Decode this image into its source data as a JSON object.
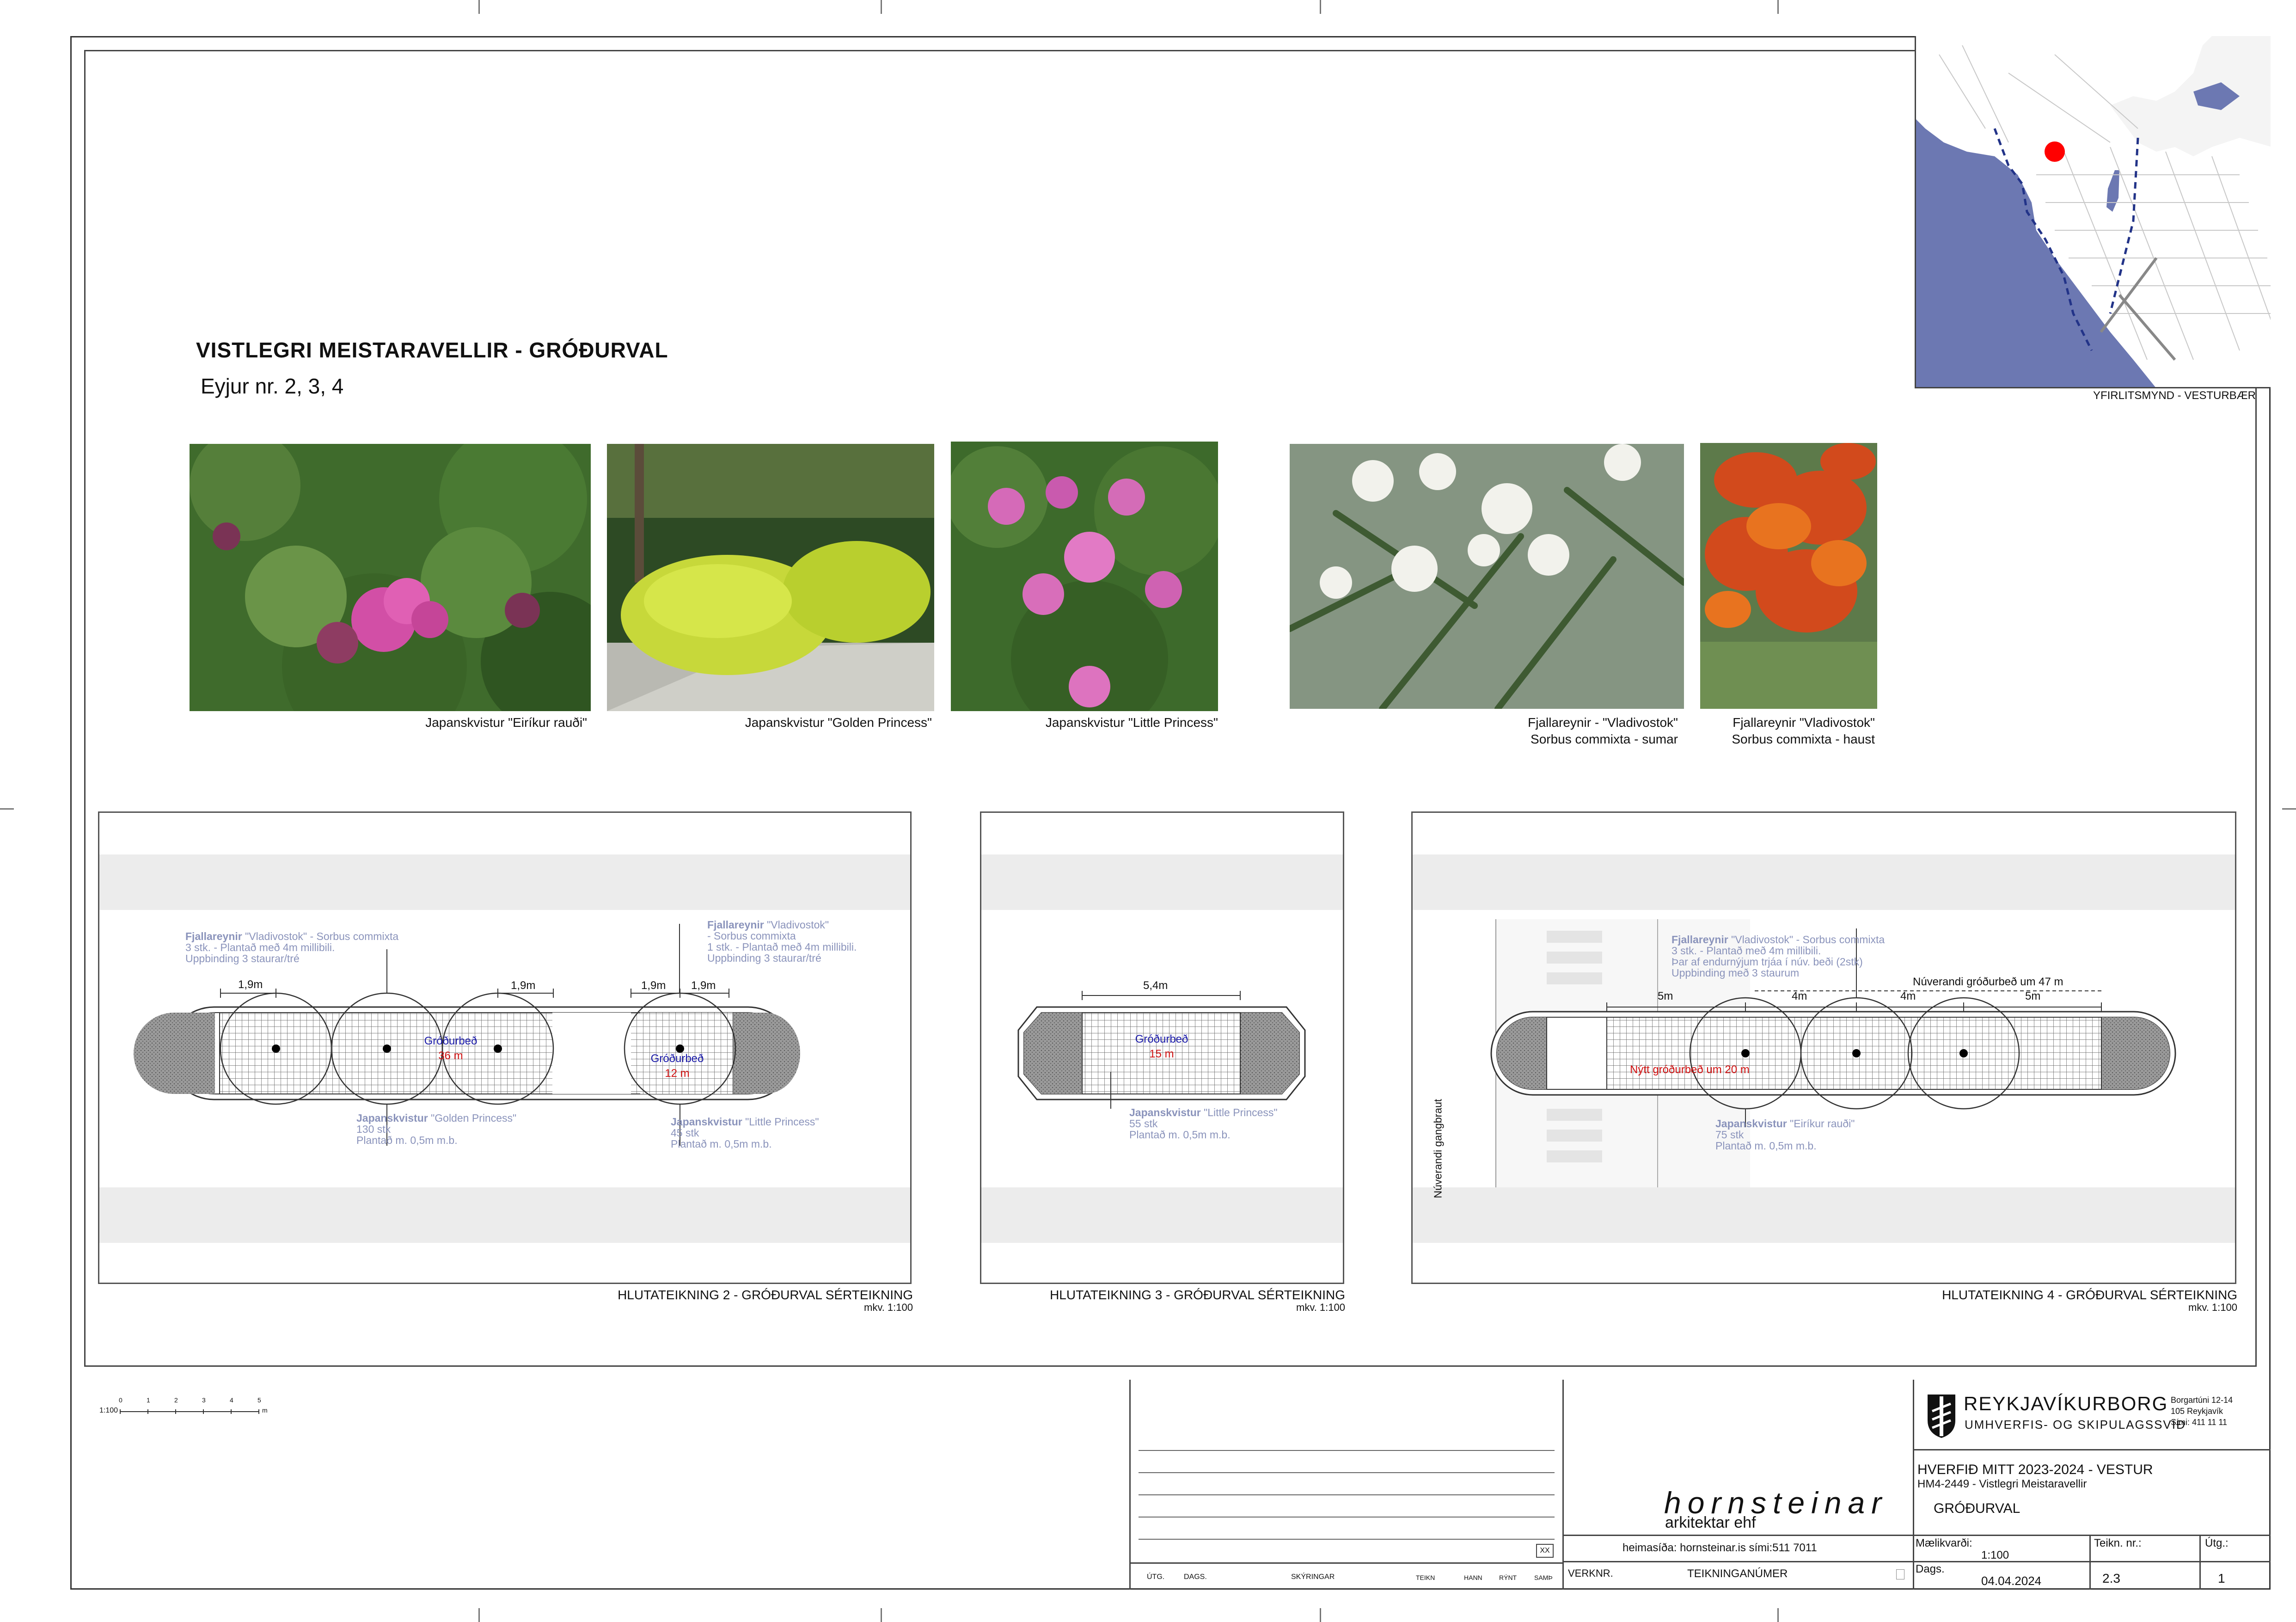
{
  "sheet": {
    "title": "VISTLEGRI MEISTARAVELLIR - GRÓÐURVAL",
    "subtitle": "Eyjur nr. 2, 3, 4"
  },
  "location_map": {
    "caption": "YFIRLITSMYND - VESTURBÆR",
    "marker_color": "#ff0000",
    "sea_color": "#6c78b2"
  },
  "photos": [
    {
      "caption": "Japanskvistur \"Eiríkur rauði\""
    },
    {
      "caption": "Japanskvistur \"Golden Princess\""
    },
    {
      "caption": "Japanskvistur \"Little Princess\""
    },
    {
      "caption_1": "Fjallareynir - \"Vladivostok\"",
      "caption_2": "Sorbus commixta - sumar"
    },
    {
      "caption_1": "Fjallareynir \"Vladivostok\"",
      "caption_2": "Sorbus commixta - haust"
    }
  ],
  "panel2": {
    "title": "HLUTATEIKNING 2 - GRÓÐURVAL SÉRTEIKNING",
    "scale": "mkv. 1:100",
    "note_trees_left": {
      "line1_bold": "Fjallareynir",
      "line1_rest": " \"Vladivostok\" - Sorbus commixta",
      "line2": "3 stk. - Plantað með 4m millibili.",
      "line3": "Uppbinding 3 staurar/tré"
    },
    "note_trees_right": {
      "line1_bold": "Fjallareynir",
      "line1_rest": " \"Vladivostok\"",
      "line2": "- Sorbus commixta",
      "line3": "1 stk. - Plantað með 4m millibili.",
      "line4": "Uppbinding 3 staurar/tré"
    },
    "dim_1": "1,9m",
    "dim_2": "1,9m",
    "dim_3": "1,9m",
    "dim_4": "1,9m",
    "bed_a_label": "Gróðurbeð",
    "bed_a_area": "36 m",
    "bed_b_label": "Gróðurbeð",
    "bed_b_area": "12 m",
    "note_shrub_a": {
      "line1_bold": "Japanskvistur",
      "line1_rest": " \"Golden Princess\"",
      "line2": "130 stk",
      "line3": "Plantað m. 0,5m m.b."
    },
    "note_shrub_b": {
      "line1_bold": "Japanskvistur",
      "line1_rest": " \"Little Princess\"",
      "line2": "45 stk",
      "line3": "Plantað m. 0,5m m.b."
    }
  },
  "panel3": {
    "title": "HLUTATEIKNING 3 - GRÓÐURVAL SÉRTEIKNING",
    "scale": "mkv. 1:100",
    "dim": "5,4m",
    "bed_label": "Gróðurbeð",
    "bed_area": "15 m",
    "note_shrub": {
      "line1_bold": "Japanskvistur",
      "line1_rest": " \"Little Princess\"",
      "line2": "55 stk",
      "line3": "Plantað m. 0,5m m.b."
    }
  },
  "panel4": {
    "title": "HLUTATEIKNING 4 - GRÓÐURVAL SÉRTEIKNING",
    "scale": "mkv. 1:100",
    "note_trees": {
      "line1_bold": "Fjallareynir",
      "line1_rest": "  \"Vladivostok\" - Sorbus commixta",
      "line2": "3 stk. - Plantað með 4m millibili.",
      "line3": "Þar af endurnýjum trjáa í núv. beði (2stk)",
      "line4": "Uppbinding með 3 staurum"
    },
    "existing_bed": "Núverandi gróðurbeð um 47 m",
    "new_bed": "Nýtt gróðurbeð um 20 m",
    "dim_5m_a": "5m",
    "dim_4m_a": "4m",
    "dim_4m_b": "4m",
    "dim_5m_b": "5m",
    "crossing": "Núverandi gangbraut",
    "note_shrub": {
      "line1_bold": "Japanskvistur",
      "line1_rest": " \"Eiríkur rauði\"",
      "line2": "75 stk",
      "line3": "Plantað m. 0,5m m.b."
    }
  },
  "title_block": {
    "scale_bar_label": "1:100",
    "scale_ticks": [
      "0",
      "1",
      "2",
      "3",
      "4",
      "5"
    ],
    "scale_unit": "m",
    "revision_headers": [
      "ÚTG.",
      "DAGS.",
      "SKÝRINGAR",
      "TEIKN",
      "HANN",
      "RÝNT",
      "SAMÞ"
    ],
    "rev_box": "XX",
    "firm_name": "hornsteinar",
    "firm_sub": "arkitektar ehf",
    "firm_contact": "heimasíða: hornsteinar.is   sími:511 7011",
    "verknr_label": "VERKNR.",
    "teikninganumer_label": "TEIKNINGANÚMER",
    "city_name": "REYKJAVÍKURBORG",
    "city_dept": "UMHVERFIS- OG SKIPULAGSSVIÐ",
    "city_addr_1": "Borgartúni 12-14",
    "city_addr_2": "105 Reykjavík",
    "city_addr_3": "Sími:  411 11 11",
    "project_1": "HVERFIÐ MITT 2023-2024 - VESTUR",
    "project_2": "HM4-2449 - Vistlegri Meistaravellir",
    "drawing_name": "GRÓÐURVAL",
    "scale_label": "Mælikvarði:",
    "scale_value": "1:100",
    "drawing_no_label": "Teikn. nr.:",
    "drawing_no_value": "2.3",
    "issue_label": "Útg.:",
    "issue_value": "1",
    "date_label": "Dags.",
    "date_value": "04.04.2024"
  }
}
